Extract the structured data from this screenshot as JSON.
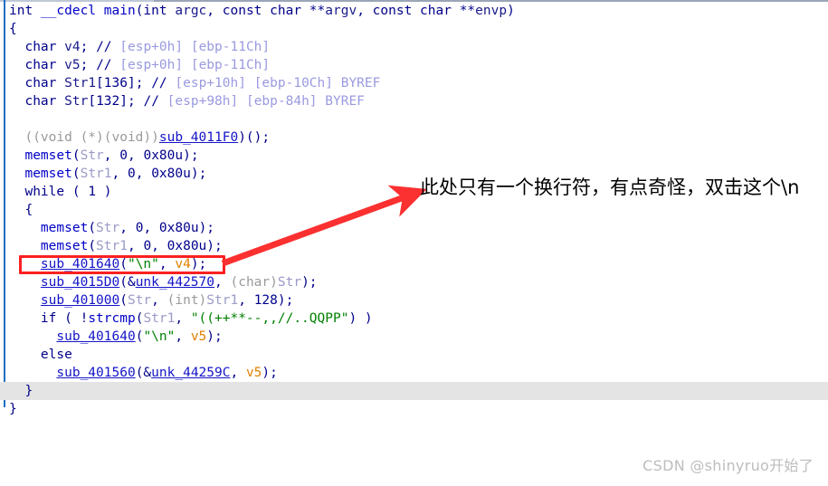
{
  "editor": {
    "kind": "ida-pseudocode-view",
    "current_line_index": 21,
    "lines": [
      {
        "indent": 0,
        "tokens": [
          {
            "t": "key",
            "v": "int "
          },
          {
            "t": "fn",
            "v": "__cdecl"
          },
          {
            "t": "plain",
            "v": " "
          },
          {
            "t": "fn",
            "v": "main"
          },
          {
            "t": "punc",
            "v": "("
          },
          {
            "t": "key",
            "v": "int"
          },
          {
            "t": "plain",
            "v": " "
          },
          {
            "t": "lvar",
            "v": "argc"
          },
          {
            "t": "punc",
            "v": ", "
          },
          {
            "t": "key",
            "v": "const char"
          },
          {
            "t": "plain",
            "v": " "
          },
          {
            "t": "punc",
            "v": "**"
          },
          {
            "t": "lvar",
            "v": "argv"
          },
          {
            "t": "punc",
            "v": ", "
          },
          {
            "t": "key",
            "v": "const char"
          },
          {
            "t": "plain",
            "v": " "
          },
          {
            "t": "punc",
            "v": "**"
          },
          {
            "t": "lvar",
            "v": "envp"
          },
          {
            "t": "punc",
            "v": ")"
          }
        ]
      },
      {
        "indent": 0,
        "tokens": [
          {
            "t": "brc",
            "v": "{"
          }
        ]
      },
      {
        "indent": 1,
        "tokens": [
          {
            "t": "key",
            "v": "char"
          },
          {
            "t": "plain",
            "v": " "
          },
          {
            "t": "lvar",
            "v": "v4"
          },
          {
            "t": "punc",
            "v": "; "
          },
          {
            "t": "cmt2",
            "v": "//"
          },
          {
            "t": "plain",
            "v": " "
          },
          {
            "t": "cmt",
            "v": "[esp+0h] [ebp-11Ch]"
          }
        ]
      },
      {
        "indent": 1,
        "tokens": [
          {
            "t": "key",
            "v": "char"
          },
          {
            "t": "plain",
            "v": " "
          },
          {
            "t": "lvar",
            "v": "v5"
          },
          {
            "t": "punc",
            "v": "; "
          },
          {
            "t": "cmt2",
            "v": "//"
          },
          {
            "t": "plain",
            "v": " "
          },
          {
            "t": "cmt",
            "v": "[esp+0h] [ebp-11Ch]"
          }
        ]
      },
      {
        "indent": 1,
        "tokens": [
          {
            "t": "key",
            "v": "char"
          },
          {
            "t": "plain",
            "v": " "
          },
          {
            "t": "lvar",
            "v": "Str1"
          },
          {
            "t": "punc",
            "v": "["
          },
          {
            "t": "num",
            "v": "136"
          },
          {
            "t": "punc",
            "v": "]; "
          },
          {
            "t": "cmt2",
            "v": "//"
          },
          {
            "t": "plain",
            "v": " "
          },
          {
            "t": "cmt",
            "v": "[esp+10h] [ebp-10Ch] BYREF"
          }
        ]
      },
      {
        "indent": 1,
        "tokens": [
          {
            "t": "key",
            "v": "char"
          },
          {
            "t": "plain",
            "v": " "
          },
          {
            "t": "lvar",
            "v": "Str"
          },
          {
            "t": "punc",
            "v": "["
          },
          {
            "t": "num",
            "v": "132"
          },
          {
            "t": "punc",
            "v": "]; "
          },
          {
            "t": "cmt2",
            "v": "//"
          },
          {
            "t": "plain",
            "v": " "
          },
          {
            "t": "cmt",
            "v": "[esp+98h] [ebp-84h] BYREF"
          }
        ]
      },
      {
        "indent": 0,
        "tokens": []
      },
      {
        "indent": 1,
        "tokens": [
          {
            "t": "cast",
            "v": "((void (*)(void))"
          },
          {
            "t": "sub",
            "v": "sub_4011F0"
          },
          {
            "t": "punc",
            "v": ")();"
          }
        ]
      },
      {
        "indent": 1,
        "tokens": [
          {
            "t": "fn",
            "v": "memset"
          },
          {
            "t": "punc",
            "v": "("
          },
          {
            "t": "var",
            "v": "Str"
          },
          {
            "t": "punc",
            "v": ", "
          },
          {
            "t": "num",
            "v": "0"
          },
          {
            "t": "punc",
            "v": ", "
          },
          {
            "t": "num",
            "v": "0x80u"
          },
          {
            "t": "punc",
            "v": ");"
          }
        ]
      },
      {
        "indent": 1,
        "tokens": [
          {
            "t": "fn",
            "v": "memset"
          },
          {
            "t": "punc",
            "v": "("
          },
          {
            "t": "var",
            "v": "Str1"
          },
          {
            "t": "punc",
            "v": ", "
          },
          {
            "t": "num",
            "v": "0"
          },
          {
            "t": "punc",
            "v": ", "
          },
          {
            "t": "num",
            "v": "0x80u"
          },
          {
            "t": "punc",
            "v": ");"
          }
        ]
      },
      {
        "indent": 1,
        "tokens": [
          {
            "t": "key",
            "v": "while"
          },
          {
            "t": "punc",
            "v": " ( "
          },
          {
            "t": "num",
            "v": "1"
          },
          {
            "t": "punc",
            "v": " )"
          }
        ]
      },
      {
        "indent": 1,
        "tokens": [
          {
            "t": "brc",
            "v": "{"
          }
        ]
      },
      {
        "indent": 2,
        "tokens": [
          {
            "t": "fn",
            "v": "memset"
          },
          {
            "t": "punc",
            "v": "("
          },
          {
            "t": "var",
            "v": "Str"
          },
          {
            "t": "punc",
            "v": ", "
          },
          {
            "t": "num",
            "v": "0"
          },
          {
            "t": "punc",
            "v": ", "
          },
          {
            "t": "num",
            "v": "0x80u"
          },
          {
            "t": "punc",
            "v": ");"
          }
        ]
      },
      {
        "indent": 2,
        "tokens": [
          {
            "t": "fn",
            "v": "memset"
          },
          {
            "t": "punc",
            "v": "("
          },
          {
            "t": "var",
            "v": "Str1"
          },
          {
            "t": "punc",
            "v": ", "
          },
          {
            "t": "num",
            "v": "0"
          },
          {
            "t": "punc",
            "v": ", "
          },
          {
            "t": "num",
            "v": "0x80u"
          },
          {
            "t": "punc",
            "v": ");"
          }
        ]
      },
      {
        "indent": 2,
        "tokens": [
          {
            "t": "sub",
            "v": "sub_401640"
          },
          {
            "t": "punc",
            "v": "("
          },
          {
            "t": "str",
            "v": "\"\\n\""
          },
          {
            "t": "punc",
            "v": ", "
          },
          {
            "t": "arg",
            "v": "v4"
          },
          {
            "t": "punc",
            "v": ");"
          }
        ]
      },
      {
        "indent": 2,
        "tokens": [
          {
            "t": "sub",
            "v": "sub_4015D0"
          },
          {
            "t": "punc",
            "v": "(&"
          },
          {
            "t": "sub",
            "v": "unk_442570"
          },
          {
            "t": "punc",
            "v": ", "
          },
          {
            "t": "cast",
            "v": "(char)"
          },
          {
            "t": "var",
            "v": "Str"
          },
          {
            "t": "punc",
            "v": ");"
          }
        ]
      },
      {
        "indent": 2,
        "tokens": [
          {
            "t": "sub",
            "v": "sub_401000"
          },
          {
            "t": "punc",
            "v": "("
          },
          {
            "t": "var",
            "v": "Str"
          },
          {
            "t": "punc",
            "v": ", "
          },
          {
            "t": "cast",
            "v": "(int)"
          },
          {
            "t": "var",
            "v": "Str1"
          },
          {
            "t": "punc",
            "v": ", "
          },
          {
            "t": "num",
            "v": "128"
          },
          {
            "t": "punc",
            "v": ");"
          }
        ]
      },
      {
        "indent": 2,
        "tokens": [
          {
            "t": "key",
            "v": "if"
          },
          {
            "t": "punc",
            "v": " ( !"
          },
          {
            "t": "fn",
            "v": "strcmp"
          },
          {
            "t": "punc",
            "v": "("
          },
          {
            "t": "var",
            "v": "Str1"
          },
          {
            "t": "punc",
            "v": ", "
          },
          {
            "t": "str",
            "v": "\"((++**--,,//..QQPP\""
          },
          {
            "t": "punc",
            "v": ") )"
          }
        ]
      },
      {
        "indent": 3,
        "tokens": [
          {
            "t": "sub",
            "v": "sub_401640"
          },
          {
            "t": "punc",
            "v": "("
          },
          {
            "t": "str",
            "v": "\"\\n\""
          },
          {
            "t": "punc",
            "v": ", "
          },
          {
            "t": "arg",
            "v": "v5"
          },
          {
            "t": "punc",
            "v": ");"
          }
        ]
      },
      {
        "indent": 2,
        "tokens": [
          {
            "t": "key",
            "v": "else"
          }
        ]
      },
      {
        "indent": 3,
        "tokens": [
          {
            "t": "sub",
            "v": "sub_401560"
          },
          {
            "t": "punc",
            "v": "(&"
          },
          {
            "t": "sub",
            "v": "unk_44259C"
          },
          {
            "t": "punc",
            "v": ", "
          },
          {
            "t": "arg",
            "v": "v5"
          },
          {
            "t": "punc",
            "v": ");"
          }
        ]
      },
      {
        "indent": 1,
        "tokens": [
          {
            "t": "brc",
            "v": "}"
          }
        ]
      },
      {
        "indent": 0,
        "tokens": [
          {
            "t": "brc",
            "v": "}"
          }
        ]
      }
    ]
  },
  "annotation": {
    "text": "此处只有一个换行符，有点奇怪，双击这个\\n",
    "color": "#fb2020",
    "arrow_color": "#fb3030",
    "highlight_box_color": "#fb2020"
  },
  "watermark": {
    "text": "CSDN @shinyruo开始了",
    "color": "#bdbdbd"
  }
}
